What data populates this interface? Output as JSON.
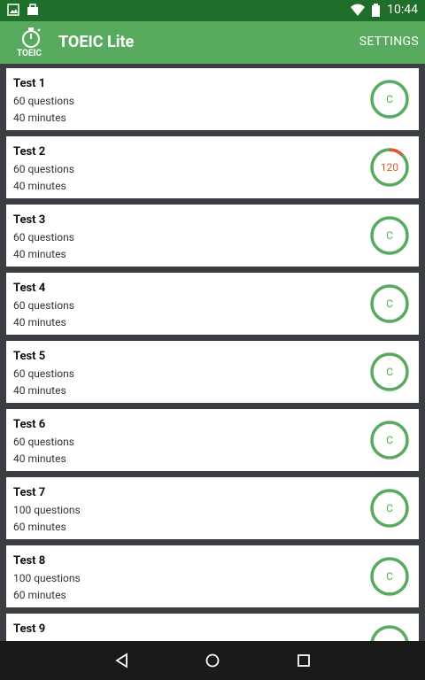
{
  "status": {
    "time": "10:44"
  },
  "app": {
    "title": "TOEIC Lite",
    "logo_text": "TOEIC",
    "settings_label": "SETTINGS"
  },
  "tests": [
    {
      "name": "Test 1",
      "questions": "60 questions",
      "minutes": "40 minutes",
      "badge": "C"
    },
    {
      "name": "Test 2",
      "questions": "60 questions",
      "minutes": "40 minutes",
      "badge": "120",
      "progress": 0.08
    },
    {
      "name": "Test 3",
      "questions": "60 questions",
      "minutes": "40 minutes",
      "badge": "C"
    },
    {
      "name": "Test 4",
      "questions": "60 questions",
      "minutes": "40 minutes",
      "badge": "C"
    },
    {
      "name": "Test 5",
      "questions": "60 questions",
      "minutes": "40 minutes",
      "badge": "C"
    },
    {
      "name": "Test 6",
      "questions": "60 questions",
      "minutes": "40 minutes",
      "badge": "C"
    },
    {
      "name": "Test 7",
      "questions": "100 questions",
      "minutes": "60 minutes",
      "badge": "C"
    },
    {
      "name": "Test 8",
      "questions": "100 questions",
      "minutes": "60 minutes",
      "badge": "C"
    },
    {
      "name": "Test 9",
      "questions": "",
      "minutes": "",
      "badge": ""
    }
  ],
  "colors": {
    "accent": "#58aa5e",
    "ring": "#4caf50",
    "progress": "#e2572b"
  }
}
